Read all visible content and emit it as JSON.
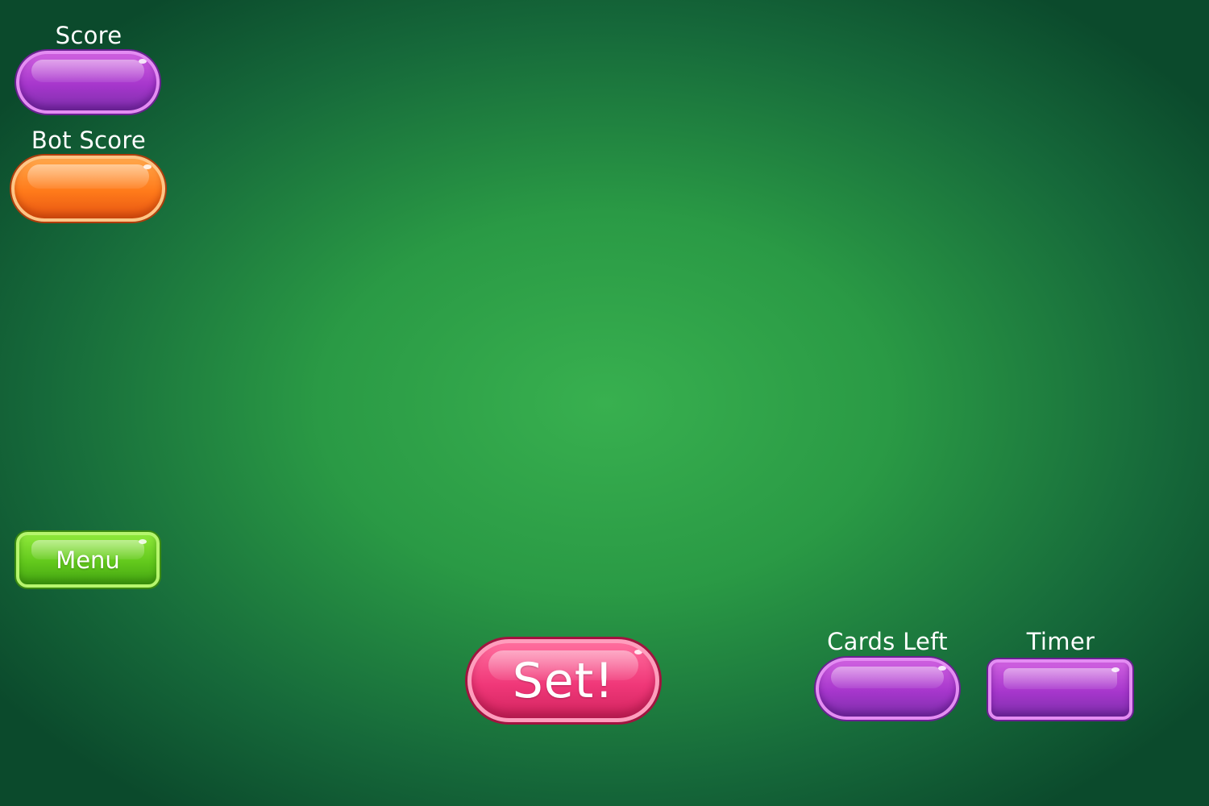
{
  "hud": {
    "score_label": "Score",
    "bot_score_label": "Bot Score",
    "cards_left_label": "Cards Left",
    "timer_label": "Timer",
    "score_value": "",
    "bot_score_value": "",
    "cards_left_value": "",
    "timer_value": ""
  },
  "buttons": {
    "menu_label": "Menu",
    "set_label": "Set!"
  },
  "colors": {
    "table_felt": "#2a9a45",
    "score_pill": "#a636cc",
    "bot_score_pill": "#ff7a1a",
    "menu_button": "#62c81c",
    "set_button": "#f03879"
  }
}
